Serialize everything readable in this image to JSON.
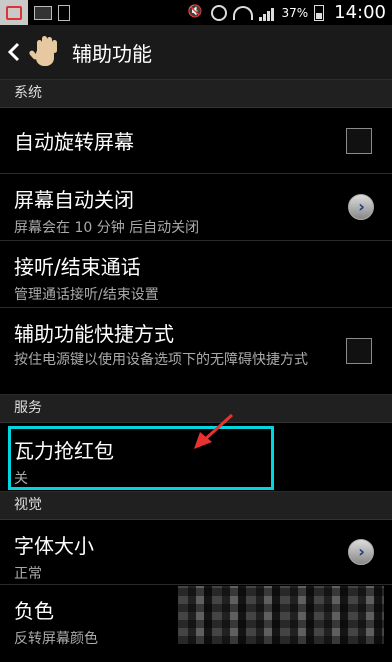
{
  "status_bar": {
    "battery_text": "37%",
    "time": "14:00"
  },
  "action_bar": {
    "title": "辅助功能"
  },
  "sections": {
    "system": "系统",
    "services": "服务",
    "vision": "视觉"
  },
  "items": {
    "auto_rotate": {
      "title": "自动旋转屏幕"
    },
    "screen_timeout": {
      "title": "屏幕自动关闭",
      "subtitle": "屏幕会在 10 分钟 后自动关闭"
    },
    "answer_end_calls": {
      "title": "接听/结束通话",
      "subtitle": "管理通话接听/结束设置"
    },
    "accessibility_shortcut": {
      "title": "辅助功能快捷方式",
      "subtitle": "按住电源键以使用设备选项下的无障碍快捷方式"
    },
    "wali_red_packet": {
      "title": "瓦力抢红包",
      "subtitle": "关"
    },
    "font_size": {
      "title": "字体大小",
      "subtitle": "正常"
    },
    "negative_colors": {
      "title": "负色",
      "subtitle": "反转屏幕颜色"
    }
  },
  "colors": {
    "highlight": "#00d6e0",
    "arrow": "#e8322f"
  }
}
